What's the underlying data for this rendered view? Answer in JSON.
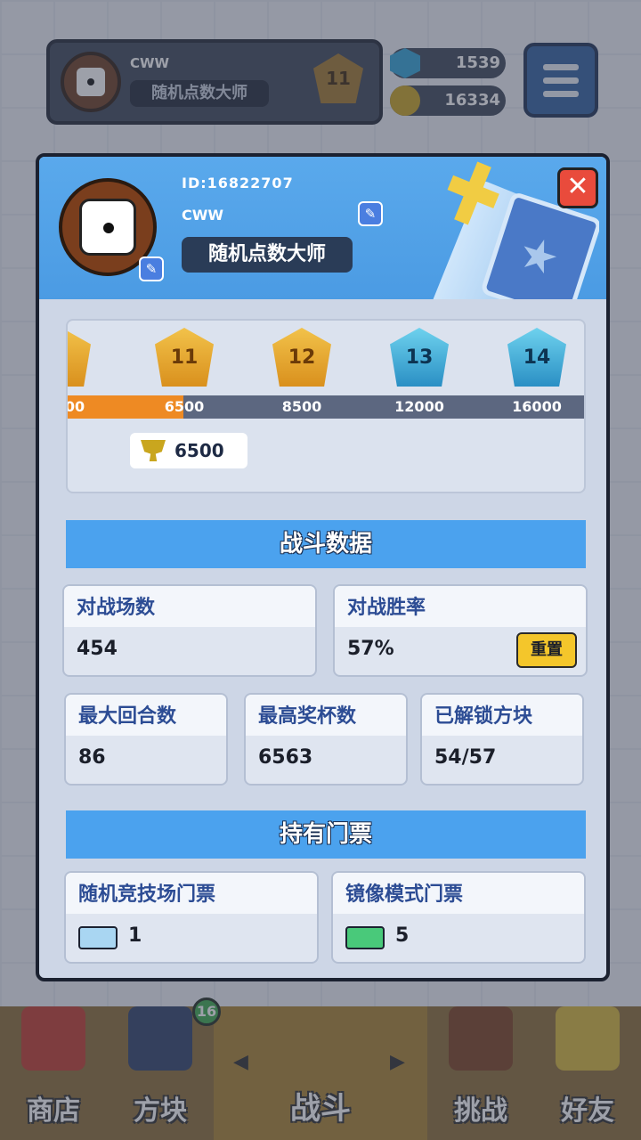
{
  "topbar": {
    "player_name": "CWW",
    "player_title": "随机点数大师",
    "rank_number": "11",
    "gems": "1539",
    "coins": "16334"
  },
  "profile": {
    "id_text": "ID:16822707",
    "name": "CWW",
    "title": "随机点数大师"
  },
  "rank_track": {
    "partial_label": "00",
    "ranks": [
      {
        "number": "11",
        "threshold": "6500",
        "tier": "gold"
      },
      {
        "number": "12",
        "threshold": "8500",
        "tier": "gold"
      },
      {
        "number": "13",
        "threshold": "12000",
        "tier": "blue"
      },
      {
        "number": "14",
        "threshold": "16000",
        "tier": "blue"
      }
    ],
    "current_trophies": "6500"
  },
  "battle_stats": {
    "section_title": "战斗数据",
    "matches_label": "对战场数",
    "matches_value": "454",
    "winrate_label": "对战胜率",
    "winrate_value": "57%",
    "reset_label": "重置",
    "max_rounds_label": "最大回合数",
    "max_rounds_value": "86",
    "max_trophies_label": "最高奖杯数",
    "max_trophies_value": "6563",
    "unlocked_label": "已解锁方块",
    "unlocked_value": "54/57"
  },
  "tickets": {
    "section_title": "持有门票",
    "arena_label": "随机竞技场门票",
    "arena_count": "1",
    "mirror_label": "镜像模式门票",
    "mirror_count": "5"
  },
  "bottom_nav": {
    "shop": "商店",
    "blocks": "方块",
    "blocks_badge": "16",
    "battle": "战斗",
    "challenge": "挑战",
    "friends": "好友"
  },
  "colors": {
    "header_blue": "#4b9be3",
    "section_blue": "#4ba2ee",
    "progress_orange": "#ee8a23",
    "close_red": "#e94b3c",
    "reset_yellow": "#f4c62b"
  }
}
